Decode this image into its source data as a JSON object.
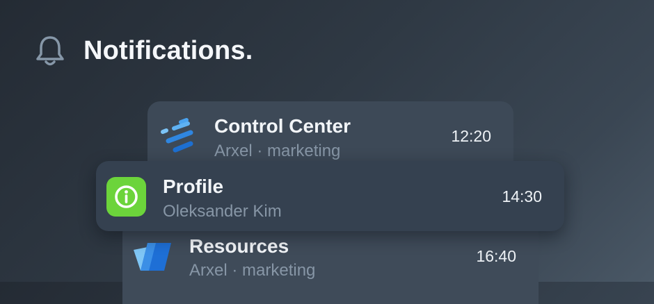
{
  "header": {
    "icon": "bell-icon",
    "title": "Notifications."
  },
  "notifications": [
    {
      "app": "Control Center",
      "subtitle": "Arxel · marketing",
      "time": "12:20",
      "icon": "control-center-logo-icon"
    },
    {
      "app": "Profile",
      "subtitle": "Oleksander Kim",
      "time": "14:30",
      "icon": "info-icon",
      "icon_color": "#6cd43b"
    },
    {
      "app": "Resources",
      "subtitle": "Arxel · marketing",
      "time": "16:40",
      "icon": "resources-logo-icon"
    }
  ]
}
